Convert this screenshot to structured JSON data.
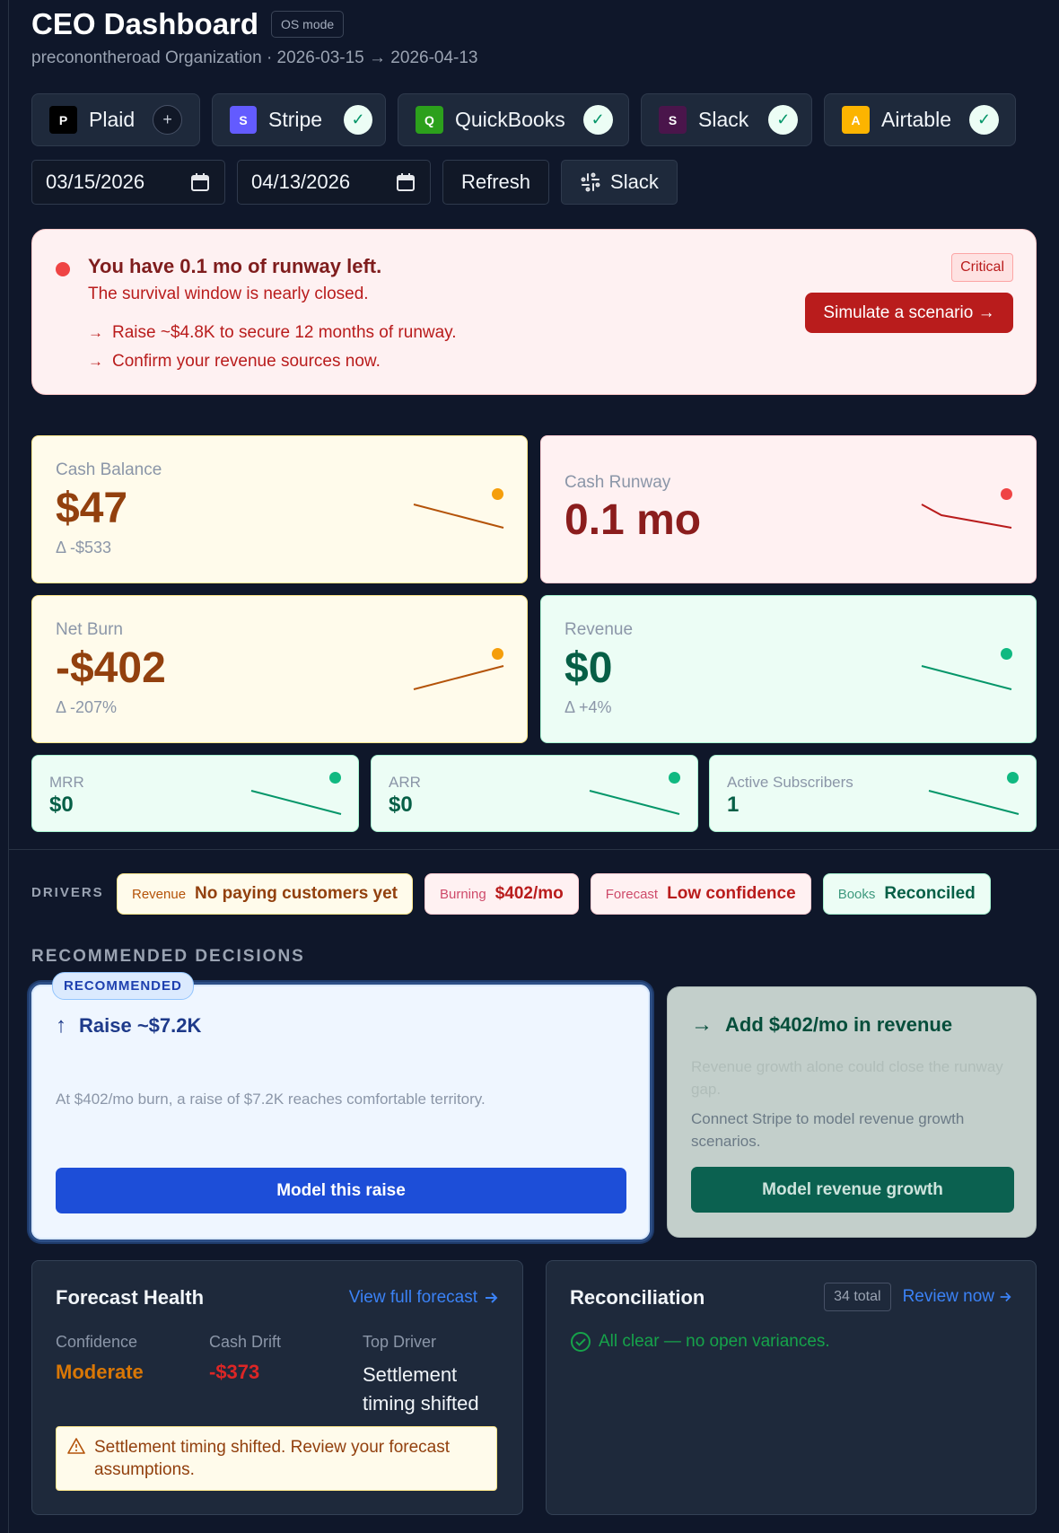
{
  "header": {
    "title": "CEO Dashboard",
    "mode_badge": "OS mode",
    "subtitle": "preconontheroad Organization · 2026-03-15 → 2026-04-13"
  },
  "integrations": [
    {
      "name": "Plaid",
      "logo_letter": "P",
      "logo_color": "#000000",
      "status": "+",
      "connected": false
    },
    {
      "name": "Stripe",
      "logo_letter": "S",
      "logo_color": "#635bff",
      "status": "✓",
      "connected": true
    },
    {
      "name": "QuickBooks",
      "logo_letter": "Q",
      "logo_color": "#2ca01c",
      "status": "✓",
      "connected": true
    },
    {
      "name": "Slack",
      "logo_letter": "S",
      "logo_color": "#4a154b",
      "status": "✓",
      "connected": true
    },
    {
      "name": "Airtable",
      "logo_letter": "A",
      "logo_color": "#fcb400",
      "status": "✓",
      "connected": true
    }
  ],
  "controls": {
    "start_date": "03/15/2026",
    "end_date": "04/13/2026",
    "refresh_label": "Refresh",
    "slack_label": "Slack"
  },
  "alert": {
    "title": "You have 0.1 mo of runway left.",
    "subtitle": "The survival window is nearly closed.",
    "items": [
      "Raise ~$4.8K to secure 12 months of runway.",
      "Confirm your revenue sources now."
    ],
    "severity": "Critical",
    "action_label": "Simulate a scenario →"
  },
  "kpis": {
    "cash_balance": {
      "label": "Cash Balance",
      "value": "$47",
      "delta": "Δ -$533",
      "status_color": "#f59e0b",
      "trend": "down"
    },
    "cash_runway": {
      "label": "Cash Runway",
      "value": "0.1 mo",
      "status_color": "#ef4444",
      "trend": "down"
    },
    "net_burn": {
      "label": "Net Burn",
      "value": "-$402",
      "delta": "Δ -207%",
      "status_color": "#f59e0b",
      "trend": "up"
    },
    "revenue": {
      "label": "Revenue",
      "value": "$0",
      "delta": "Δ +4%",
      "status_color": "#10b981",
      "trend": "down"
    },
    "mrr": {
      "label": "MRR",
      "value": "$0",
      "status_color": "#10b981"
    },
    "arr": {
      "label": "ARR",
      "value": "$0",
      "status_color": "#10b981"
    },
    "active_subscribers": {
      "label": "Active Subscribers",
      "value": "1",
      "status_color": "#10b981"
    }
  },
  "drivers": {
    "label": "DRIVERS",
    "chips": [
      {
        "key": "Revenue",
        "value": "No paying customers yet"
      },
      {
        "key": "Burning",
        "value": "$402/mo"
      },
      {
        "key": "Forecast",
        "value": "Low confidence"
      },
      {
        "key": "Books",
        "value": "Reconciled"
      }
    ]
  },
  "decisions": {
    "section_title": "RECOMMENDED DECISIONS",
    "recommended": {
      "badge": "RECOMMENDED",
      "icon": "↑",
      "title": "Raise ~$7.2K",
      "text": "At $402/mo burn, a raise of $7.2K reaches comfortable territory.",
      "button": "Model this raise"
    },
    "alternative": {
      "icon": "→",
      "title": "Add $402/mo in revenue",
      "faded_text": "Revenue growth alone could close the runway gap.",
      "text": "Connect Stripe to model revenue growth scenarios.",
      "button": "Model revenue growth"
    }
  },
  "forecast_health": {
    "title": "Forecast Health",
    "link": "View full forecast",
    "confidence_label": "Confidence",
    "confidence_value": "Moderate",
    "drift_label": "Cash Drift",
    "drift_value": "-$373",
    "driver_label": "Top Driver",
    "driver_value": "Settlement timing shifted",
    "warning": "Settlement timing shifted. Review your forecast assumptions."
  },
  "reconciliation": {
    "title": "Reconciliation",
    "total_badge": "34 total",
    "link": "Review now",
    "status": "All clear — no open variances."
  }
}
